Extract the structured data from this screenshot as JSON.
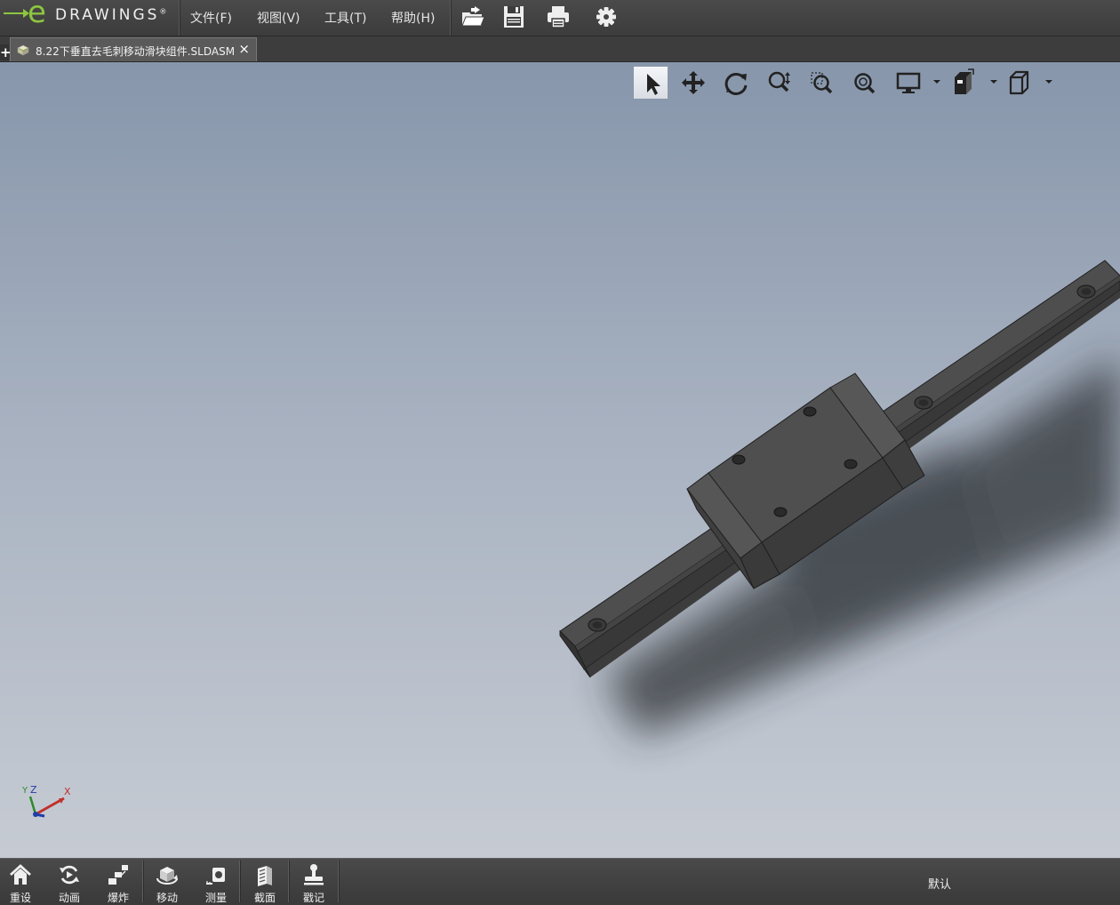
{
  "app": {
    "brand_mark": "e",
    "brand_word": "DRAWINGS",
    "brand_reg": "®"
  },
  "menu": {
    "items": [
      {
        "label": "文件(F)"
      },
      {
        "label": "视图(V)"
      },
      {
        "label": "工具(T)"
      },
      {
        "label": "帮助(H)"
      }
    ],
    "toolbar_icons": [
      "open-folder-icon",
      "save-icon",
      "print-icon",
      "settings-gear-icon"
    ]
  },
  "tabs": {
    "add_label": "+",
    "active": {
      "title": "8.22下垂直去毛刺移动滑块组件.SLDASM",
      "close_label": "×",
      "icon": "assembly-icon"
    }
  },
  "view_toolbar": {
    "tools": [
      {
        "icon": "select-arrow-icon",
        "active": true
      },
      {
        "icon": "pan-move-icon"
      },
      {
        "icon": "rotate-icon"
      },
      {
        "icon": "zoom-in-out-icon"
      },
      {
        "icon": "zoom-to-area-icon"
      },
      {
        "icon": "zoom-to-fit-icon"
      },
      {
        "icon": "display-monitor-icon",
        "dropdown": true
      },
      {
        "icon": "section-views-icon",
        "dropdown": true
      },
      {
        "icon": "view-orientation-cube-icon",
        "dropdown": true
      }
    ]
  },
  "triad": {
    "x_label": "X",
    "y_label": "Y",
    "z_label": "Z"
  },
  "bottom_toolbar": {
    "buttons": [
      {
        "label": "重设",
        "icon": "home-reset-icon"
      },
      {
        "label": "动画",
        "icon": "animate-icon"
      },
      {
        "label": "爆炸",
        "icon": "explode-icon"
      },
      {
        "label": "移动",
        "icon": "move-component-icon"
      },
      {
        "label": "测量",
        "icon": "measure-icon"
      },
      {
        "label": "截面",
        "icon": "section-icon"
      },
      {
        "label": "戳记",
        "icon": "stamp-icon"
      }
    ],
    "configuration": "默认"
  },
  "colors": {
    "brand_green": "#8dc63f",
    "chrome_dark": "#3c3c3c",
    "viewport_top": "#8796ab",
    "viewport_bottom": "#c6cbd3",
    "model_gray": "#4d4d4d"
  }
}
